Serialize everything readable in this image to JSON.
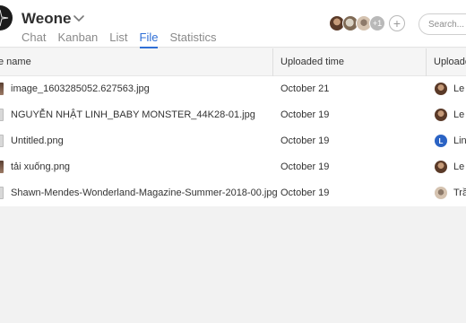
{
  "header": {
    "title": "Weone",
    "tabs": [
      {
        "label": "Chat",
        "active": false
      },
      {
        "label": "Kanban",
        "active": false
      },
      {
        "label": "List",
        "active": false
      },
      {
        "label": "File",
        "active": true
      },
      {
        "label": "Statistics",
        "active": false
      }
    ],
    "members_more_label": "+1",
    "search_placeholder": "Search...",
    "accent_color": "#2f6fd6"
  },
  "table": {
    "columns": [
      "e name",
      "Uploaded time",
      "Uploade"
    ],
    "rows": [
      {
        "file_name": "image_1603285052.627563.jpg",
        "uploaded_time": "October 21",
        "uploader": "Le N",
        "file_icon": "image-file-icon",
        "avatar": "photo"
      },
      {
        "file_name": "NGUYỄN NHẬT LINH_BABY MONSTER_44K28-01.jpg",
        "uploaded_time": "October 19",
        "uploader": "Le N",
        "file_icon": "document-file-icon",
        "avatar": "photo"
      },
      {
        "file_name": "Untitled.png",
        "uploaded_time": "October 19",
        "uploader": "Lin",
        "file_icon": "document-file-icon",
        "avatar": "initial",
        "avatar_initial": "L"
      },
      {
        "file_name": "tải xuống.png",
        "uploaded_time": "October 19",
        "uploader": "Le N",
        "file_icon": "image-file-icon",
        "avatar": "photo"
      },
      {
        "file_name": "Shawn-Mendes-Wonderland-Magazine-Summer-2018-00.jpg",
        "uploaded_time": "October 19",
        "uploader": "Trầ",
        "file_icon": "document-file-icon",
        "avatar": "photo-alt"
      }
    ]
  }
}
